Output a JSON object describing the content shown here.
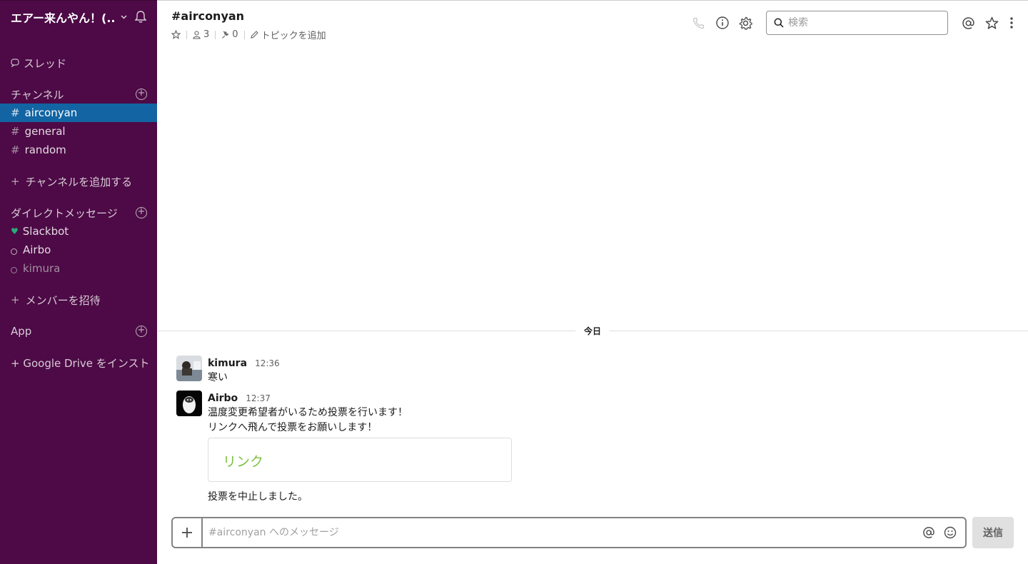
{
  "workspace": {
    "name": "エアー来んやん！(..."
  },
  "sidebar": {
    "threads_label": "スレッド",
    "channels_header": "チャンネル",
    "channels": [
      {
        "name": "airconyan",
        "active": true
      },
      {
        "name": "general",
        "active": false
      },
      {
        "name": "random",
        "active": false
      }
    ],
    "add_channel_label": "チャンネルを追加する",
    "dm_header": "ダイレクトメッセージ",
    "dms": [
      {
        "name": "Slackbot",
        "status": "heart"
      },
      {
        "name": "Airbo",
        "status": "offline"
      },
      {
        "name": "kimura",
        "status": "away"
      }
    ],
    "invite_label": "メンバーを招待",
    "app_header": "App",
    "google_drive_label": "+ Google Drive をインスト..."
  },
  "header": {
    "channel_title": "#airconyan",
    "members_count": "3",
    "pins_count": "0",
    "add_topic_label": "トピックを追加",
    "search_placeholder": "検索"
  },
  "messages": {
    "day_label": "今日",
    "items": [
      {
        "author": "kimura",
        "time": "12:36",
        "lines": [
          "寒い"
        ]
      },
      {
        "author": "Airbo",
        "time": "12:37",
        "lines": [
          "温度変更希望者がいるため投票を行います！",
          "リンクへ飛んで投票をお願いします！"
        ],
        "attachment_link": "リンク",
        "after_text": "投票を中止しました。"
      }
    ]
  },
  "composer": {
    "placeholder": "#airconyan へのメッセージ",
    "send_label": "送信"
  },
  "colors": {
    "sidebar_bg": "#4d0a46",
    "active_channel": "#1264a3",
    "link_green": "#7cc242",
    "presence_green": "#2bac76"
  }
}
